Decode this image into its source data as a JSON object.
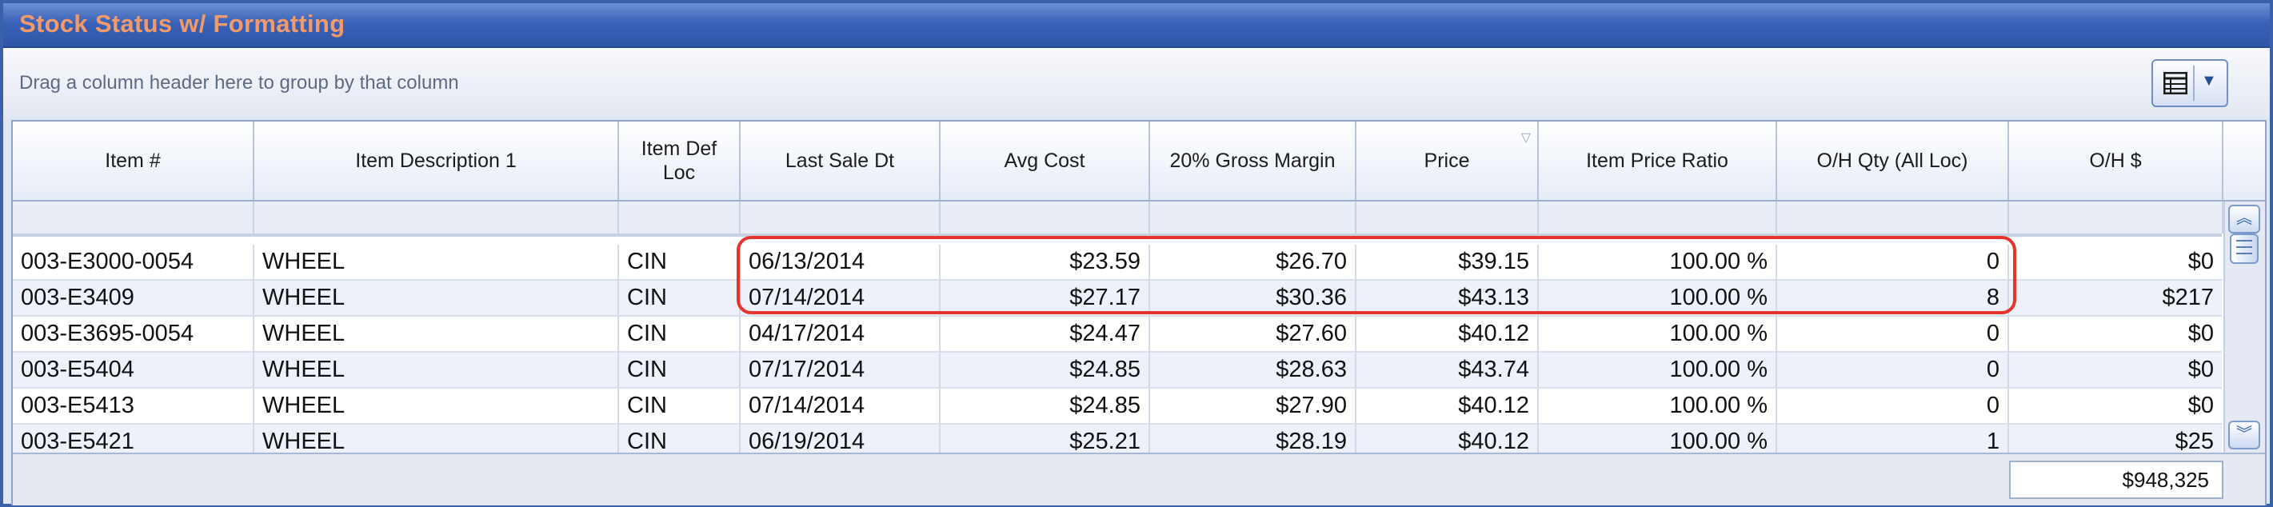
{
  "window": {
    "title": "Stock Status w/ Formatting"
  },
  "group_bar": {
    "hint": "Drag a column header here to group by that column"
  },
  "icons": {
    "view_menu": "grid-view-icon",
    "chevron": "chevron-down-icon",
    "sort": "sort-indicator-icon"
  },
  "columns": [
    "Item #",
    "Item Description 1",
    "Item Def Loc",
    "Last Sale Dt",
    "Avg Cost",
    "20% Gross Margin",
    "Price",
    "Item Price Ratio",
    "O/H Qty (All Loc)",
    "O/H $"
  ],
  "rows": [
    [
      "003-E3000-0054",
      "WHEEL",
      "CIN",
      "06/13/2014",
      "$23.59",
      "$26.70",
      "$39.15",
      "100.00 %",
      "0",
      "$0"
    ],
    [
      "003-E3409",
      "WHEEL",
      "CIN",
      "07/14/2014",
      "$27.17",
      "$30.36",
      "$43.13",
      "100.00 %",
      "8",
      "$217"
    ],
    [
      "003-E3695-0054",
      "WHEEL",
      "CIN",
      "04/17/2014",
      "$24.47",
      "$27.60",
      "$40.12",
      "100.00 %",
      "0",
      "$0"
    ],
    [
      "003-E5404",
      "WHEEL",
      "CIN",
      "07/17/2014",
      "$24.85",
      "$28.63",
      "$43.74",
      "100.00 %",
      "0",
      "$0"
    ],
    [
      "003-E5413",
      "WHEEL",
      "CIN",
      "07/14/2014",
      "$24.85",
      "$27.90",
      "$40.12",
      "100.00 %",
      "0",
      "$0"
    ],
    [
      "003-E5421",
      "WHEEL",
      "CIN",
      "06/19/2014",
      "$25.21",
      "$28.19",
      "$40.12",
      "100.00 %",
      "1",
      "$25"
    ]
  ],
  "footer": {
    "total_oh_value": "$948,325"
  },
  "colors": {
    "title_text": "#f39a6b",
    "title_bar": "#3a62b6",
    "highlight": "#e6342a"
  }
}
